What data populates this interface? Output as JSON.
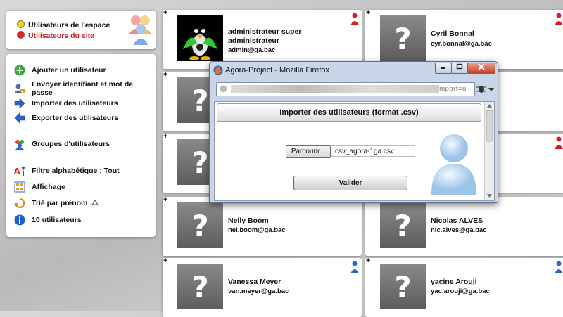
{
  "space_panel": {
    "items": [
      {
        "label": "Utilisateurs de l'espace",
        "color": "#111111",
        "dot": "#f1d21f"
      },
      {
        "label": "Utilisateurs du site",
        "color": "#d42020",
        "dot": "#e02424"
      }
    ],
    "icon": "users-group-icon"
  },
  "menu": {
    "items": [
      {
        "label": "Ajouter un utilisateur",
        "icon": "add-user-icon"
      },
      {
        "label": "Envoyer identifiant et mot de passe",
        "icon": "send-credentials-icon"
      },
      {
        "label": "Importer des utilisateurs",
        "icon": "import-arrow-icon"
      },
      {
        "label": "Exporter des utilisateurs",
        "icon": "export-arrow-icon"
      },
      {
        "label": "Groupes d'utilisateurs",
        "icon": "groups-icon"
      },
      {
        "label": "Filtre alphabétique : Tout",
        "icon": "alpha-filter-icon"
      },
      {
        "label": "Affichage",
        "icon": "display-icon"
      },
      {
        "label": "Trié par  prénom",
        "icon": "sort-icon"
      },
      {
        "label": "10 utilisateurs",
        "icon": "info-icon"
      }
    ]
  },
  "users": [
    {
      "name": "administrateur super administrateur",
      "email": "admin@ga.bac",
      "photo": "tux-icon",
      "pin": "red"
    },
    {
      "name": "Cyril Bonnal",
      "email": "cyr.bonnal@ga.bac",
      "photo": "placeholder",
      "pin": "red"
    },
    {
      "name": "Nelly Boom",
      "email": "nel.boom@ga.bac",
      "photo": "placeholder",
      "pin": ""
    },
    {
      "name": "Nicolas ALVES",
      "email": "nic.alves@ga.bac",
      "photo": "placeholder",
      "pin": ""
    },
    {
      "name": "Vanessa Meyer",
      "email": "van.meyer@ga.bac",
      "photo": "placeholder",
      "pin": "blue"
    },
    {
      "name": "yacine Arouji",
      "email": "yac.arouji@ga.bac",
      "photo": "placeholder",
      "pin": "blue"
    }
  ],
  "dialog": {
    "title": "Agora-Project - Mozilla Firefox",
    "url": "mport=u",
    "heading": "Importer des utilisateurs (format .csv)",
    "browse_label": "Parcourir...",
    "file_name": "csv_agora-1ga.csv",
    "submit_label": "Valider",
    "window_buttons": [
      "minimize",
      "maximize",
      "close"
    ]
  },
  "colors": {
    "pin_red": "#d92020",
    "pin_blue": "#2266d8"
  }
}
